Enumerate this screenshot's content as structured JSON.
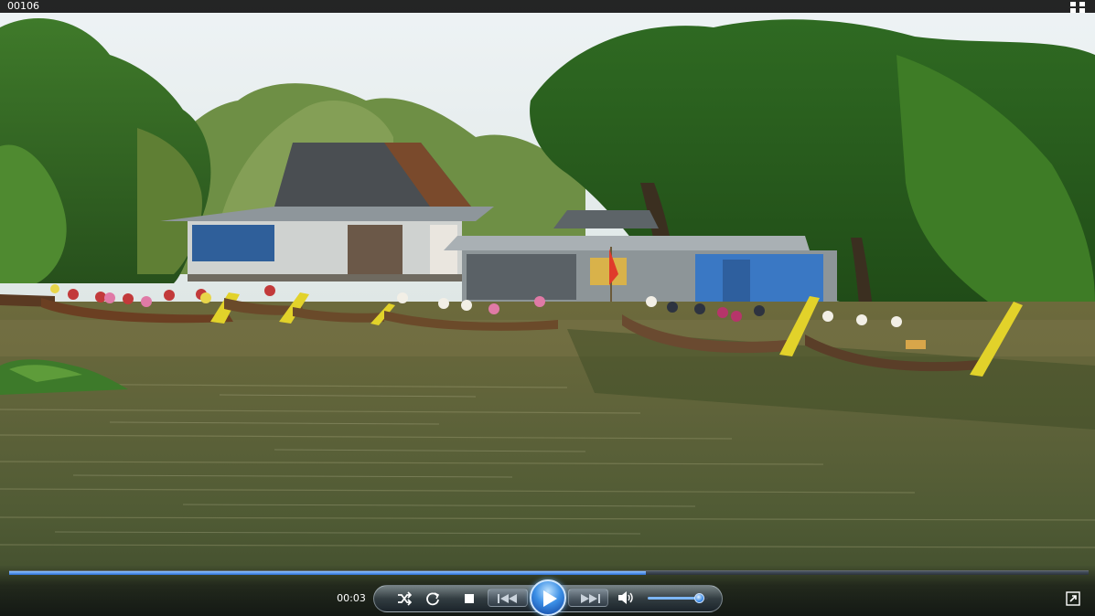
{
  "window": {
    "title": "00106"
  },
  "playback": {
    "elapsed": "00:03",
    "progress_fraction": 0.59,
    "volume_fraction": 0.85
  },
  "icons": {
    "fullscreen": "fullscreen-toggle-icon",
    "shuffle": "shuffle-icon",
    "repeat": "repeat-icon",
    "stop": "stop-icon",
    "previous": "previous-track-icon",
    "play": "play-icon",
    "next": "next-track-icon",
    "volume": "volume-speaker-icon",
    "switch_to_library": "switch-to-library-icon"
  },
  "colors": {
    "accent": "#3b8fe6",
    "progress": "#2b6fd6",
    "bar_background": "#000000"
  }
}
